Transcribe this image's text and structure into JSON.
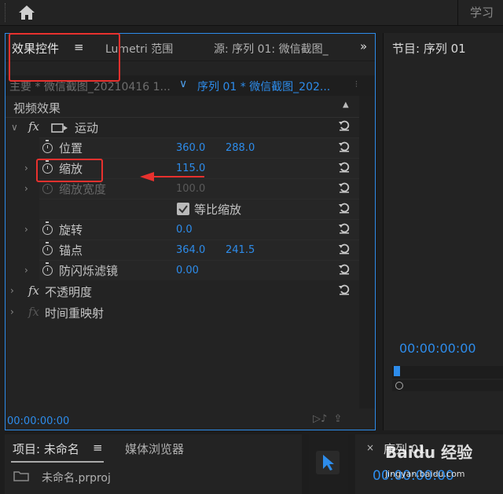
{
  "topbar": {
    "home_icon": "home-icon",
    "right_label": "学习"
  },
  "effect_controls": {
    "tabs": [
      {
        "label": "效果控件",
        "menu": "≡"
      },
      {
        "label": "Lumetri 范围"
      },
      {
        "label": "源: 序列 01: 微信截图_"
      }
    ],
    "more_glyph": "»",
    "master_label": "主要 * 微信截图_20210416 1...",
    "sequence_label": "序列 01 * 微信截图_202...",
    "section_title": "视频效果",
    "rows": [
      {
        "fx": "fx",
        "label": "运动"
      },
      {
        "label": "位置",
        "v1": "360.0",
        "v2": "288.0"
      },
      {
        "label": "缩放",
        "v1": "115.0"
      },
      {
        "label": "缩放宽度",
        "v1": "100.0"
      },
      {
        "label": "等比缩放"
      },
      {
        "label": "旋转",
        "v1": "0.0"
      },
      {
        "label": "锚点",
        "v1": "364.0",
        "v2": "241.5"
      },
      {
        "label": "防闪烁滤镜",
        "v1": "0.00"
      },
      {
        "fx": "fx",
        "label": "不透明度"
      },
      {
        "fx": "fx",
        "label": "时间重映射"
      }
    ],
    "timecode": "00:00:00:00"
  },
  "program_monitor": {
    "title": "节目: 序列 01",
    "timecode": "00:00:00:00"
  },
  "project": {
    "title": "项目: 未命名",
    "menu": "≡",
    "media_tab": "媒体浏览器",
    "file": "未命名.prproj"
  },
  "timeline": {
    "close": "×",
    "title": "序列 01",
    "timecode": "00:00:00:00"
  },
  "watermark": {
    "logo": "Baidu 经验",
    "sub": "jingyan.baidu.com"
  },
  "colors": {
    "accent": "#2d8ceb",
    "highlight": "#e8312e",
    "panel": "#232323"
  }
}
